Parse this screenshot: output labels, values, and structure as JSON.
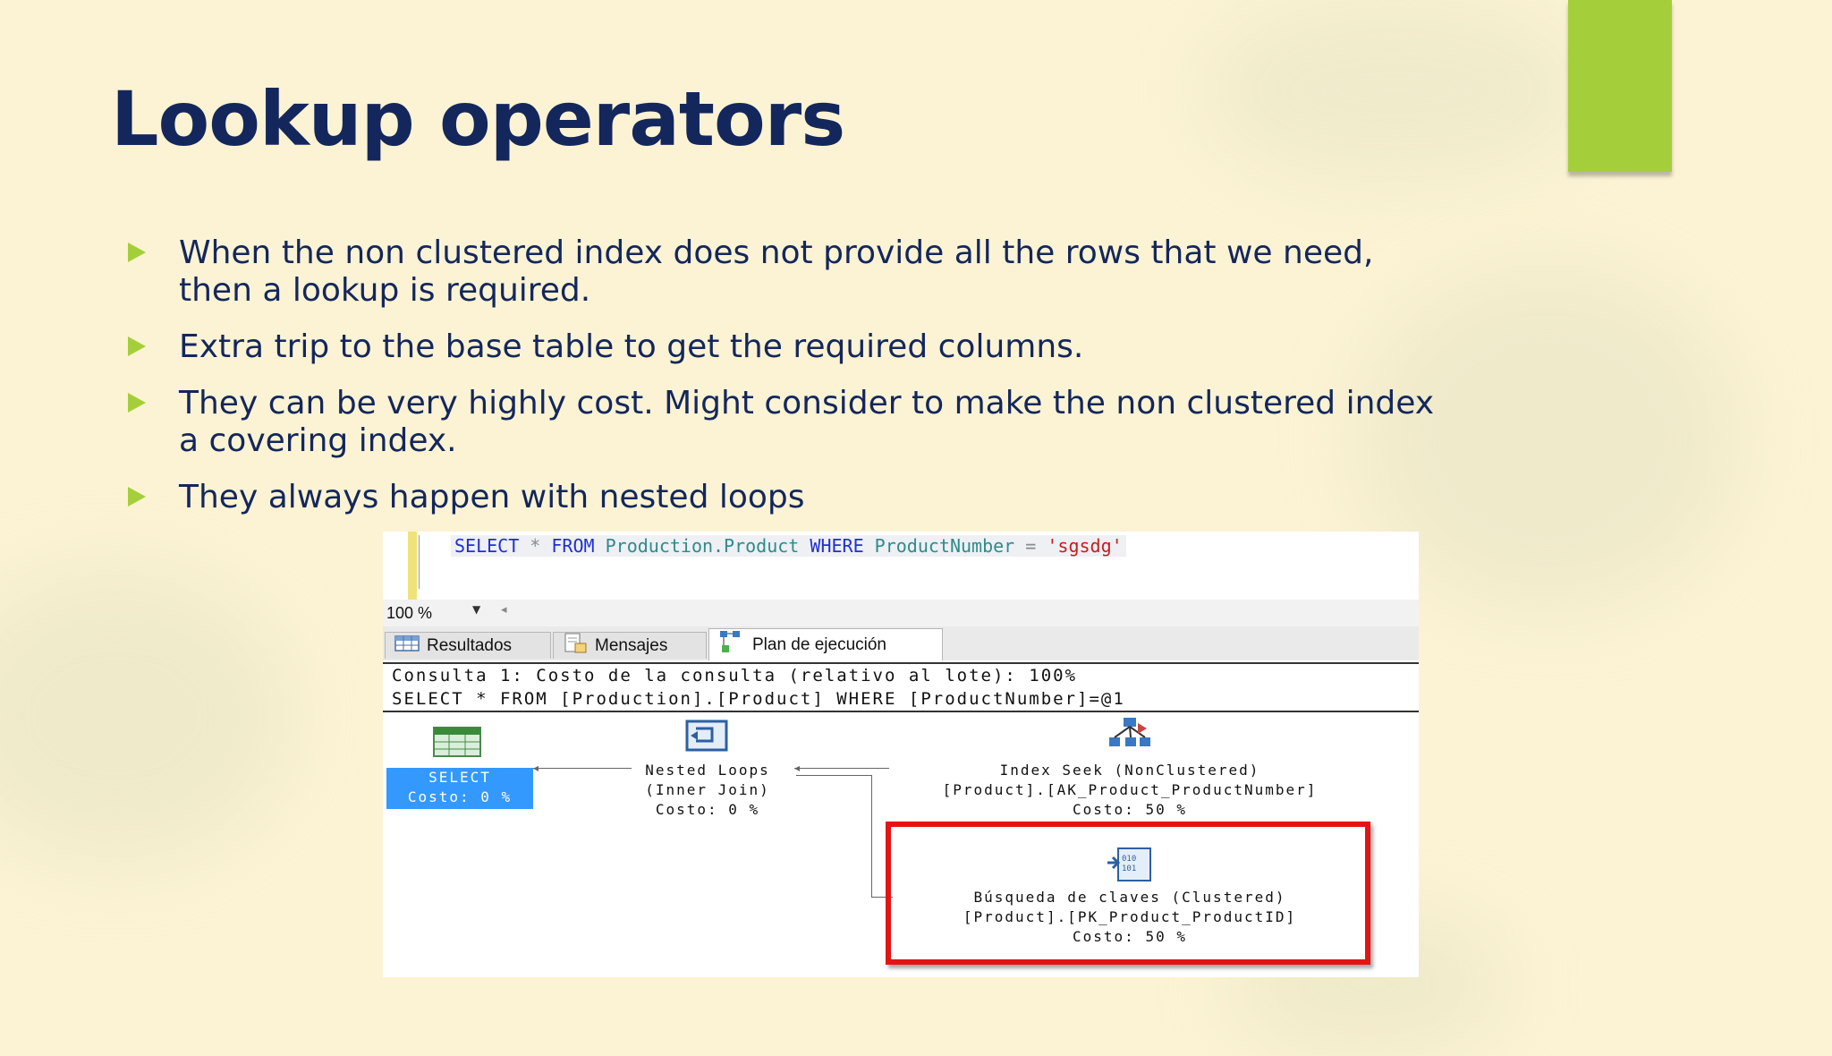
{
  "slide": {
    "title": "Lookup operators",
    "bullets": [
      {
        "line1": "When the non clustered index does not provide all the rows that we need,",
        "line2": "then a lookup is required."
      },
      {
        "line1": "Extra trip to the base table to get the required columns.",
        "line2": ""
      },
      {
        "line1": "They can be very highly cost. Might consider to make the non clustered index",
        "line2": "a covering index."
      },
      {
        "line1": "They always happen with nested loops",
        "line2": ""
      }
    ]
  },
  "colors": {
    "accent": "#a5cf3a",
    "title": "#14275c",
    "highlight": "#e41414",
    "selected": "#3399ff"
  },
  "ssms": {
    "sql": {
      "kw_select": "SELECT",
      "star": "*",
      "kw_from": "FROM",
      "table": "Production.Product",
      "kw_where": "WHERE",
      "column": "ProductNumber",
      "equals": "=",
      "value": "'sgsdg'"
    },
    "zoom": "100 %",
    "tabs": [
      {
        "label": "Resultados",
        "icon": "grid-icon"
      },
      {
        "label": "Mensajes",
        "icon": "messages-icon"
      },
      {
        "label": "Plan de ejecución",
        "icon": "execution-plan-icon"
      }
    ],
    "plan_header": {
      "line1": "Consulta 1: Costo de la consulta (relativo al lote): 100%",
      "line2": "SELECT * FROM [Production].[Product] WHERE [ProductNumber]=@1"
    },
    "operators": {
      "select": {
        "name": "SELECT",
        "cost": "Costo: 0 %"
      },
      "nested_loops": {
        "name": "Nested Loops",
        "detail": "(Inner Join)",
        "cost": "Costo: 0 %"
      },
      "index_seek": {
        "name": "Index Seek (NonClustered)",
        "detail": "[Product].[AK_Product_ProductNumber]",
        "cost": "Costo: 50 %"
      },
      "key_lookup": {
        "name": "Búsqueda de claves (Clustered)",
        "detail": "[Product].[PK_Product_ProductID]",
        "cost": "Costo: 50 %"
      }
    }
  }
}
